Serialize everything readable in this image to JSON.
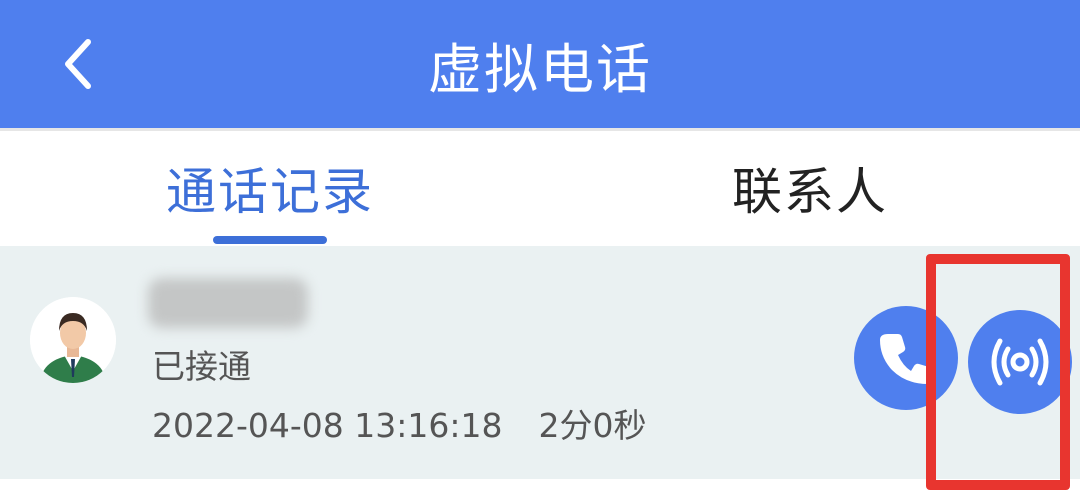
{
  "header": {
    "title": "虚拟电话",
    "back_icon": "chevron-left-icon",
    "color": "#4f7fee"
  },
  "tabs": [
    {
      "label": "通话记录",
      "active": true
    },
    {
      "label": "联系人",
      "active": false
    }
  ],
  "record": {
    "status": "已接通",
    "datetime": "2022-04-08 13:16:18",
    "duration": "2分0秒",
    "avatar_icon": "male-avatar-icon",
    "actions": [
      {
        "icon": "phone-icon"
      },
      {
        "icon": "recording-icon"
      }
    ]
  },
  "accent_color": "#3d6fd8",
  "highlight_color": "#e8352f"
}
